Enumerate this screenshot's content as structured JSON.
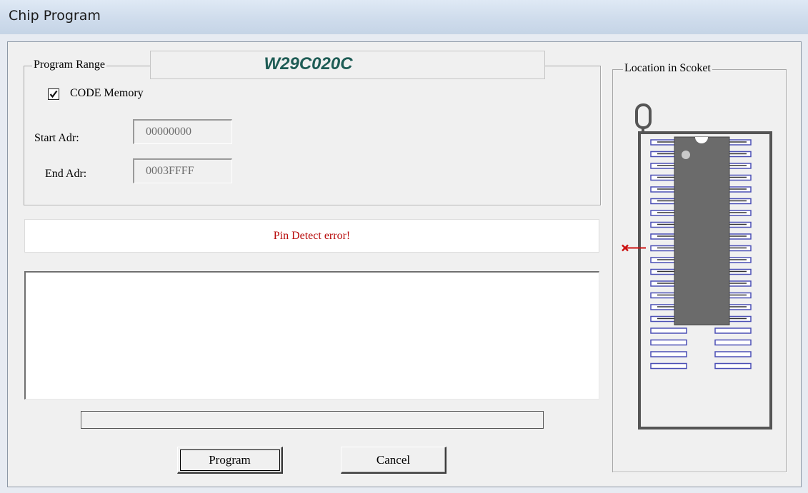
{
  "window": {
    "title": "Chip Program"
  },
  "program_range": {
    "legend": "Program Range",
    "chip_name": "W29C020C",
    "code_memory": {
      "label": "CODE Memory",
      "checked": true
    },
    "start_adr": {
      "label": "Start Adr:",
      "value": "00000000"
    },
    "end_adr": {
      "label": "End Adr:",
      "value": "0003FFFF"
    }
  },
  "status": {
    "message": "Pin Detect error!",
    "color": "#b80d0d"
  },
  "log": {
    "text": ""
  },
  "progress": {
    "fraction": 0
  },
  "buttons": {
    "program": "Program",
    "cancel": "Cancel"
  },
  "socket": {
    "legend": "Location in Scoket",
    "pins_per_side": 20,
    "chip_pins_per_side": 16,
    "error_pin_side": "left",
    "error_pin_index": 9,
    "chip_color": "#6b6b6b",
    "slot_color": "#4b4fb5",
    "error_color": "#cc1111"
  }
}
